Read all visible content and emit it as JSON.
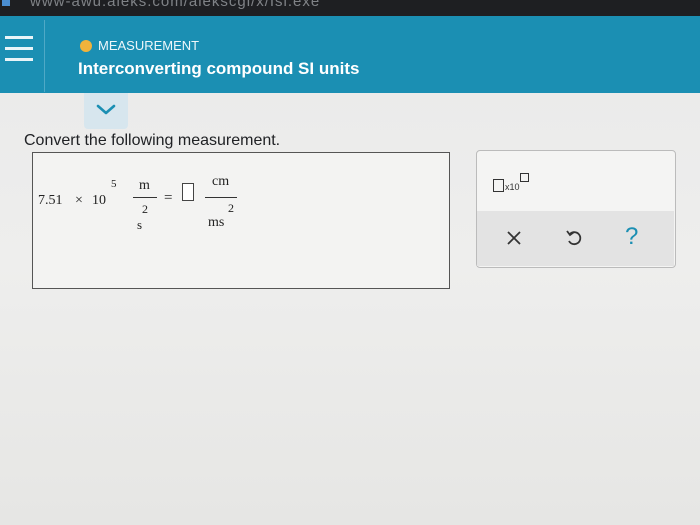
{
  "browser": {
    "url_fragment": "www-awu.aleks.com/alekscgi/x/Isl.exe"
  },
  "header": {
    "topic": "MEASUREMENT",
    "topic_color": "#f1b33b",
    "title": "Interconverting compound SI units",
    "bar_color": "#1b8fb3"
  },
  "question": {
    "instruction": "Convert the following measurement.",
    "coefficient": "7.51",
    "times": "×",
    "base": "10",
    "exponent": "5",
    "given_num_unit": "m",
    "given_den_unit": "s",
    "given_den_exp": "2",
    "equals": "=",
    "answer_value": "",
    "target_num_unit": "cm",
    "target_den_unit": "ms",
    "target_den_exp": "2"
  },
  "tools": {
    "sci_notation_label": "x10",
    "clear_icon": "close-icon",
    "undo_icon": "undo-icon",
    "help_label": "?"
  }
}
